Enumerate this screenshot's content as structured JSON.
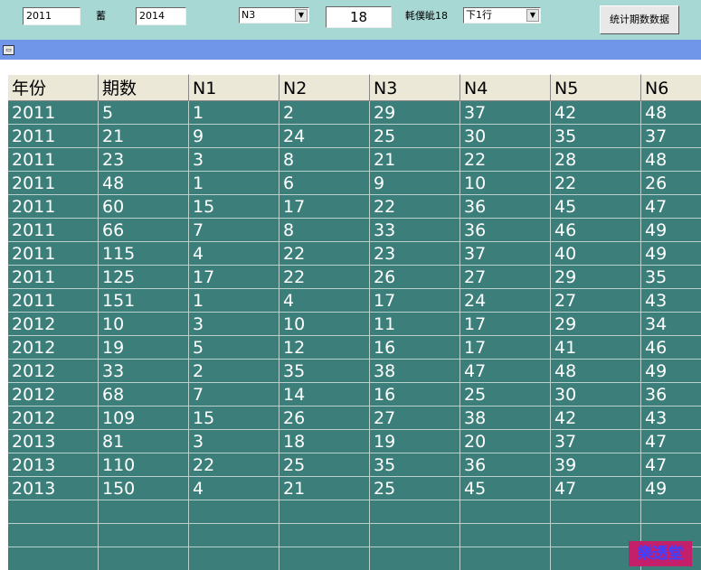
{
  "toolbar": {
    "year_from": "2011",
    "separator": "蓄",
    "year_to": "2014",
    "column_select": "N3",
    "number_value": "18",
    "label_text": "軞僕皉18",
    "row_select": "下1行",
    "stat_button": "统计期数数据"
  },
  "table": {
    "headers": [
      "年份",
      "期数",
      "N1",
      "N2",
      "N3",
      "N4",
      "N5",
      "N6"
    ],
    "rows": [
      [
        "2011",
        "5",
        "1",
        "2",
        "29",
        "37",
        "42",
        "48"
      ],
      [
        "2011",
        "21",
        "9",
        "24",
        "25",
        "30",
        "35",
        "37"
      ],
      [
        "2011",
        "23",
        "3",
        "8",
        "21",
        "22",
        "28",
        "48"
      ],
      [
        "2011",
        "48",
        "1",
        "6",
        "9",
        "10",
        "22",
        "26"
      ],
      [
        "2011",
        "60",
        "15",
        "17",
        "22",
        "36",
        "45",
        "47"
      ],
      [
        "2011",
        "66",
        "7",
        "8",
        "33",
        "36",
        "46",
        "49"
      ],
      [
        "2011",
        "115",
        "4",
        "22",
        "23",
        "37",
        "40",
        "49"
      ],
      [
        "2011",
        "125",
        "17",
        "22",
        "26",
        "27",
        "29",
        "35"
      ],
      [
        "2011",
        "151",
        "1",
        "4",
        "17",
        "24",
        "27",
        "43"
      ],
      [
        "2012",
        "10",
        "3",
        "10",
        "11",
        "17",
        "29",
        "34"
      ],
      [
        "2012",
        "19",
        "5",
        "12",
        "16",
        "17",
        "41",
        "46"
      ],
      [
        "2012",
        "33",
        "2",
        "35",
        "38",
        "47",
        "48",
        "49"
      ],
      [
        "2012",
        "68",
        "7",
        "14",
        "16",
        "25",
        "30",
        "36"
      ],
      [
        "2012",
        "109",
        "15",
        "26",
        "27",
        "38",
        "42",
        "43"
      ],
      [
        "2013",
        "81",
        "3",
        "18",
        "19",
        "20",
        "37",
        "47"
      ],
      [
        "2013",
        "110",
        "22",
        "25",
        "35",
        "36",
        "39",
        "47"
      ],
      [
        "2013",
        "150",
        "4",
        "21",
        "25",
        "45",
        "47",
        "49"
      ]
    ],
    "empty_rows": 3
  },
  "watermark": "樂透堂",
  "colors": {
    "background": "#a8d8d4",
    "grid_background": "#3c7f7a",
    "strip": "#6f96e8",
    "header": "#ece8d8"
  }
}
